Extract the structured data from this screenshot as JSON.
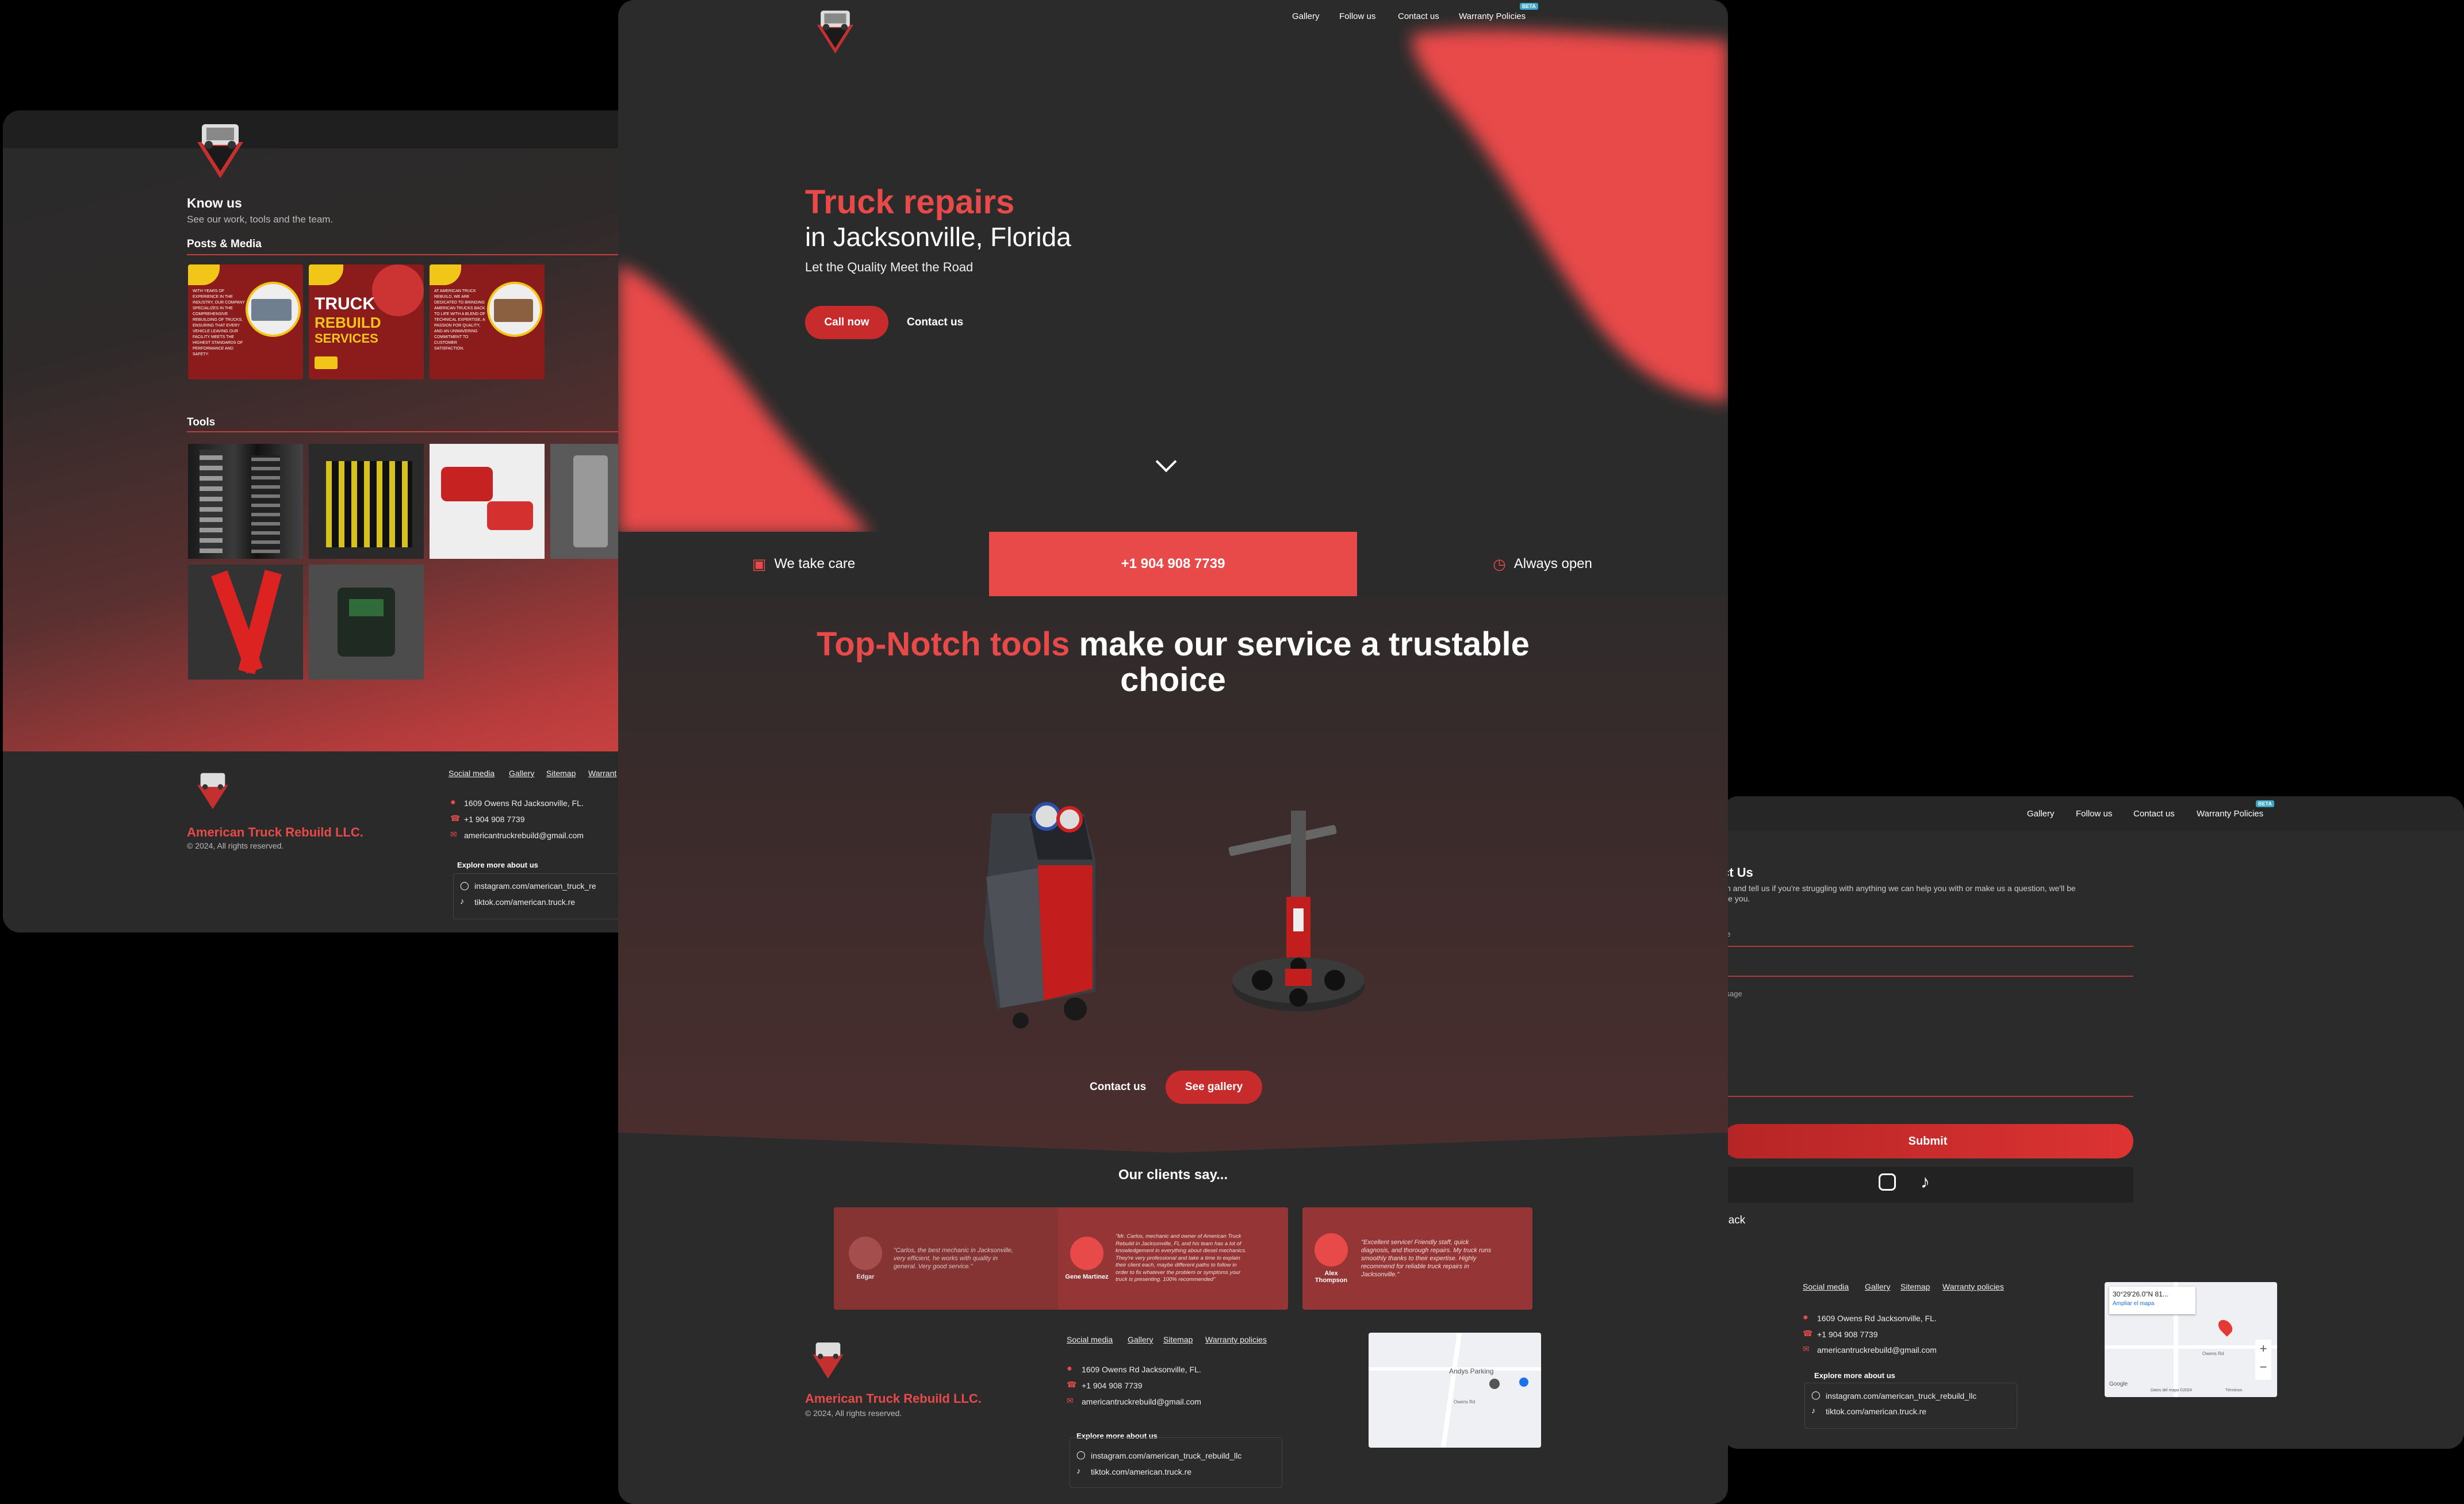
{
  "brand": {
    "name": "American Truck Rebuild LLC.",
    "copyright": "© 2024, All rights reserved.",
    "colors": {
      "accent": "#e84a4a",
      "dark": "#2b2b2b",
      "button": "#c72b2b"
    }
  },
  "nav": {
    "gallery": "Gallery",
    "follow": "Follow us",
    "contact": "Contact us",
    "warranty": "Warranty Policies",
    "beta": "BETA"
  },
  "gallery_page": {
    "know_title": "Know us",
    "know_sub": "See our work, tools and the team.",
    "posts_title": "Posts & Media",
    "tools_title": "Tools",
    "posts": [
      {
        "text": "WITH YEARS OF EXPERIENCE IN THE INDUSTRY, OUR COMPANY SPECIALIZES IN THE COMPREHENSIVE REBUILDING OF TRUCKS, ENSURING THAT EVERY VEHICLE LEAVING OUR FACILITY MEETS THE HIGHEST STANDARDS OF PERFORMANCE AND SAFETY."
      },
      {
        "l1": "TRUCK",
        "l2": "REBUILD",
        "l3": "SERVICES"
      },
      {
        "text": "AT AMERICAN TRUCK REBUILD, WE ARE DEDICATED TO BRINGING AMERICAN TRUCKS BACK TO LIFE WITH A BLEND OF TECHNICAL EXPERTISE, A PASSION FOR QUALITY, AND AN UNWAVERING COMMITMENT TO CUSTOMER SATISFACTION."
      }
    ]
  },
  "home": {
    "hero_title": "Truck repairs",
    "hero_location": "in Jacksonville, Florida",
    "hero_tagline": "Let the Quality Meet the Road",
    "call_now": "Call now",
    "contact_us": "Contact us",
    "strip_care": "We take care",
    "strip_phone": "+1 904 908 7739",
    "strip_open": "Always open",
    "tools_heading_accent": "Top-Notch tools",
    "tools_heading_rest": "make our service a trustable",
    "tools_heading_line2": "choice",
    "contact_btn": "Contact us",
    "see_gallery": "See gallery",
    "clients_title": "Our clients say...",
    "testimonials": [
      {
        "name": "Edgar",
        "text": "\"Carlos, the best mechanic in Jacksonville, very efficient, he works with quality in general. Very good service.\""
      },
      {
        "name": "Gene Martinez",
        "text": "\"Mr. Carlos, mechanic and owner of American Truck Rebuild in Jacksonville, FL and his team has a lot of knowledgement in everything about diesel mechanics. They're very professional and take a time to explain their client each, maybe different paths to follow in order to fix whatever the problem or symptoms your truck is presenting. 100% recommended\""
      },
      {
        "name": "Alex Thompson",
        "text": "\"Excellent service! Friendly staff, quick diagnosis, and thorough repairs. My truck runs smoothly thanks to their expertise. Highly recommend for reliable truck repairs in Jacksonville.\""
      }
    ]
  },
  "footer": {
    "links": [
      "Social media",
      "Gallery",
      "Sitemap",
      "Warranty policies"
    ],
    "address": "1609 Owens Rd Jacksonville, FL.",
    "phone": "+1 904 908 7739",
    "email": "americantruckrebuild@gmail.com",
    "explore": "Explore more about us",
    "instagram": "instagram.com/american_truck_rebuild_llc",
    "tiktok": "tiktok.com/american.truck.re",
    "left_links": [
      "Social media",
      "Gallery",
      "Sitemap",
      "Warrant"
    ],
    "left_instagram": "instagram.com/american_truck_re"
  },
  "map": {
    "place": "Andys Parking",
    "road": "Owens Rd",
    "coords": "30°29'26.0\"N 81...",
    "enlarge": "Ampliar el mapa",
    "google": "Google",
    "map_data": "Datos del mapa ©2024",
    "terms": "Términos"
  },
  "contact_page": {
    "title": "ct Us",
    "description_l1": "ch and tell us if you're struggling with anything we can help you with or make us a question, we'll be",
    "description_l2": "ive you.",
    "name_label": "ne",
    "message_label": "ssage",
    "submit": "Submit",
    "back": "back"
  }
}
